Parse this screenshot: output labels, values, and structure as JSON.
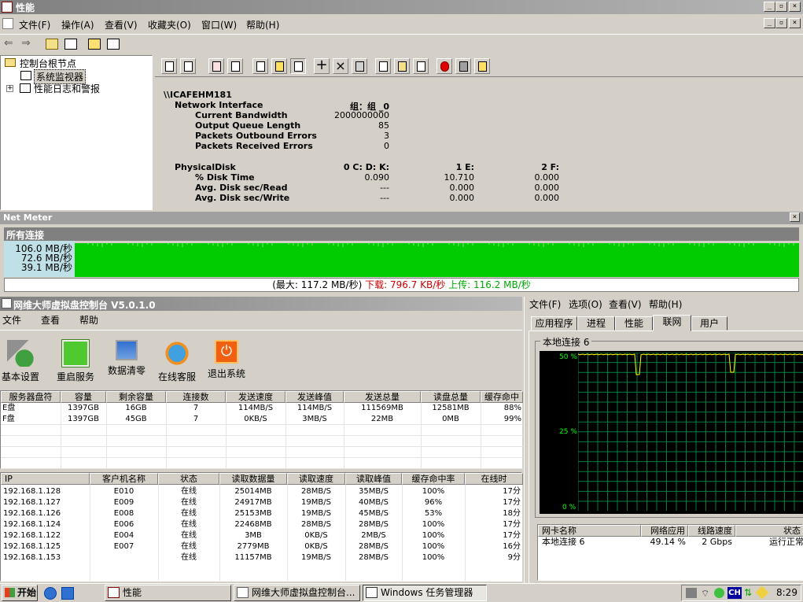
{
  "window": {
    "title": "性能"
  },
  "menu": {
    "items": [
      "文件(F)",
      "操作(A)",
      "查看(V)",
      "收藏夹(O)",
      "窗口(W)",
      "帮助(H)"
    ]
  },
  "tree": {
    "root": "控制台根节点",
    "items": [
      "系统监视器",
      "性能日志和警报"
    ]
  },
  "report": {
    "host": "\\\\ICAFEHM181",
    "net": {
      "name": "Network Interface",
      "instance": "组：组 _0",
      "rows": [
        [
          "Current Bandwidth",
          "2000000000"
        ],
        [
          "Output Queue Length",
          "85"
        ],
        [
          "Packets Outbound Errors",
          "3"
        ],
        [
          "Packets Received Errors",
          "0"
        ]
      ]
    },
    "disk": {
      "name": "PhysicalDisk",
      "cols": [
        "0 C: D: K:",
        "1 E:",
        "2 F:"
      ],
      "rows": [
        [
          "% Disk Time",
          "0.090",
          "10.710",
          "0.000"
        ],
        [
          "Avg. Disk sec/Read",
          "---",
          "0.000",
          "0.000"
        ],
        [
          "Avg. Disk sec/Write",
          "---",
          "0.000",
          "0.000"
        ]
      ]
    }
  },
  "netmeter": {
    "title": "Net Meter",
    "subtitle": "所有连接",
    "scale": [
      "106.0 MB/秒",
      "72.6 MB/秒",
      "39.1 MB/秒"
    ],
    "status_max": "(最大: 117.2 MB/秒)",
    "status_down": "下载: 796.7 KB/秒",
    "status_up": "上传: 116.2 MB/秒",
    "colors": {
      "graph": "#00cc00",
      "down": "#cc0000",
      "up": "#00aa00"
    }
  },
  "vd": {
    "title": "网维大师虚拟盘控制台 V5.0.1.0",
    "menu": [
      "文件",
      "查看",
      "帮助"
    ],
    "buttons": [
      "基本设置",
      "重启服务",
      "数据清零",
      "在线客服",
      "退出系统"
    ],
    "disk_headers": [
      "服务器盘符",
      "容量",
      "剩余容量",
      "连接数",
      "发送速度",
      "发送峰值",
      "发送总量",
      "读盘总量",
      "缓存命中"
    ],
    "disks": [
      [
        "E盘",
        "1397GB",
        "16GB",
        "7",
        "114MB/S",
        "114MB/S",
        "111569MB",
        "12581MB",
        "88%"
      ],
      [
        "F盘",
        "1397GB",
        "45GB",
        "7",
        "0KB/S",
        "3MB/S",
        "22MB",
        "0MB",
        "99%"
      ]
    ],
    "client_headers": [
      "IP",
      "客户机名称",
      "状态",
      "读取数据量",
      "读取速度",
      "读取峰值",
      "缓存命中率",
      "在线时"
    ],
    "clients": [
      [
        "192.168.1.128",
        "E010",
        "在线",
        "25014MB",
        "28MB/S",
        "35MB/S",
        "100%",
        "17分"
      ],
      [
        "192.168.1.127",
        "E009",
        "在线",
        "24917MB",
        "19MB/S",
        "40MB/S",
        "96%",
        "17分"
      ],
      [
        "192.168.1.126",
        "E008",
        "在线",
        "25153MB",
        "19MB/S",
        "45MB/S",
        "53%",
        "18分"
      ],
      [
        "192.168.1.124",
        "E006",
        "在线",
        "22468MB",
        "28MB/S",
        "28MB/S",
        "100%",
        "17分"
      ],
      [
        "192.168.1.122",
        "E004",
        "在线",
        "3MB",
        "0KB/S",
        "2MB/S",
        "100%",
        "17分"
      ],
      [
        "192.168.1.125",
        "E007",
        "在线",
        "2779MB",
        "0KB/S",
        "28MB/S",
        "100%",
        "16分"
      ],
      [
        "192.168.1.153",
        "",
        "在线",
        "11157MB",
        "19MB/S",
        "28MB/S",
        "100%",
        "9分"
      ]
    ]
  },
  "tm": {
    "menu": [
      "文件(F)",
      "选项(O)",
      "查看(V)",
      "帮助(H)"
    ],
    "tabs": [
      "应用程序",
      "进程",
      "性能",
      "联网",
      "用户"
    ],
    "group": "本地连接 6",
    "y_ticks": [
      "50 %",
      "25 %",
      "0 %"
    ],
    "headers": [
      "网卡名称",
      "网络应用",
      "线路速度",
      "状态"
    ],
    "row": [
      "本地连接 6",
      "49.14 %",
      "2 Gbps",
      "运行正常"
    ]
  },
  "taskbar": {
    "start": "开始",
    "tasks": [
      "性能",
      "网维大师虚拟盘控制台...",
      "Windows 任务管理器"
    ],
    "ime": "CH",
    "clock": "8:29"
  }
}
